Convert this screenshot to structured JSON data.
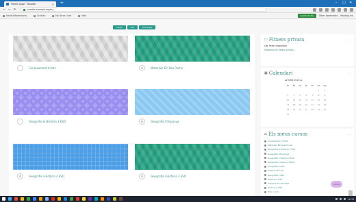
{
  "browser": {
    "tab_title": "Home page · Moodle",
    "new_tab_symbol": "+",
    "url": "moodle.example.org/my",
    "bookmarks": [
      {
        "label": "Institut Bookmarks"
      },
      {
        "label": "Scholar"
      },
      {
        "label": "My Drive Links"
      },
      {
        "label": "Mail"
      }
    ],
    "bm_button": "Switch Profile",
    "bm_right_links": [
      "Other bookmarks",
      "Reading list"
    ]
  },
  "view_toggle": [
    "Cards",
    "List",
    "Summary"
  ],
  "courses": [
    {
      "name": "Coneixement d'Arts",
      "pattern": "grey",
      "icon": "course-icon"
    },
    {
      "name": "Materials EP. Xea Puche",
      "pattern": "green",
      "icon": "course-icon"
    },
    {
      "name": "Geografia & Història 1 ESO",
      "pattern": "purple",
      "icon": "course-icon"
    },
    {
      "name": "Geografia d'Espanya",
      "pattern": "lightblue",
      "icon": "course-icon"
    },
    {
      "name": "Geografia i Història 2 ESO",
      "pattern": "blue",
      "icon": "course-icon"
    },
    {
      "name": "Geografia i Història 3 ESO",
      "pattern": "green",
      "icon": "course-icon"
    }
  ],
  "sidebar": {
    "private_files": {
      "title": "Fitxers privats",
      "line": "Cap fitxer disponible",
      "link": "Gestiona els fitxers privats..."
    },
    "calendar": {
      "title": "Calendari",
      "month": "◄   maig 2021   ►",
      "headers": [
        "Dl",
        "Dt",
        "Dc",
        "Dj",
        "Dv",
        "Ds",
        "Dg"
      ],
      "days": [
        "",
        "",
        "",
        "",
        "",
        "1",
        "2",
        "3",
        "4",
        "5",
        "6",
        "7",
        "8",
        "9",
        "10",
        "11",
        "12",
        "13",
        "14",
        "15",
        "16",
        "17",
        "18",
        "19",
        "20",
        "21",
        "22",
        "23",
        "24",
        "25",
        "26",
        "27",
        "28",
        "29",
        "30",
        "31"
      ]
    },
    "my_courses": {
      "title": "Els meus cursos",
      "items": [
        "Coneixement d'Arts",
        "Materials EP. Xea Puche",
        "Geografia & Història 1 ESO",
        "Geografia d'Espanya",
        "Geografia i Història 2 ESO",
        "Geografia i Història 3 ESO",
        "Geografia 4 ESO",
        "Història de l'Art",
        "Geografia 2 BAT",
        "Història 2 BAT",
        "Ciències Socials ESO",
        "Tutoria 1r ESO",
        "Més cursos..."
      ]
    }
  },
  "fab_label": "Ajuda",
  "taskbar": {
    "clock": "12:34",
    "icon_colors": [
      "#ffffff",
      "#3fa9f5",
      "#e94b3c",
      "#f4c20d",
      "#34a853",
      "#4285f4",
      "#f4a300",
      "#8ab4f8",
      "#d93025",
      "#ffb300",
      "#1e88e5",
      "#43a047",
      "#e53935",
      "#fdd835",
      "#5e35b1",
      "#00acc1",
      "#fb8c00",
      "#3949ab",
      "#c0ca33",
      "#6d4c41"
    ]
  }
}
